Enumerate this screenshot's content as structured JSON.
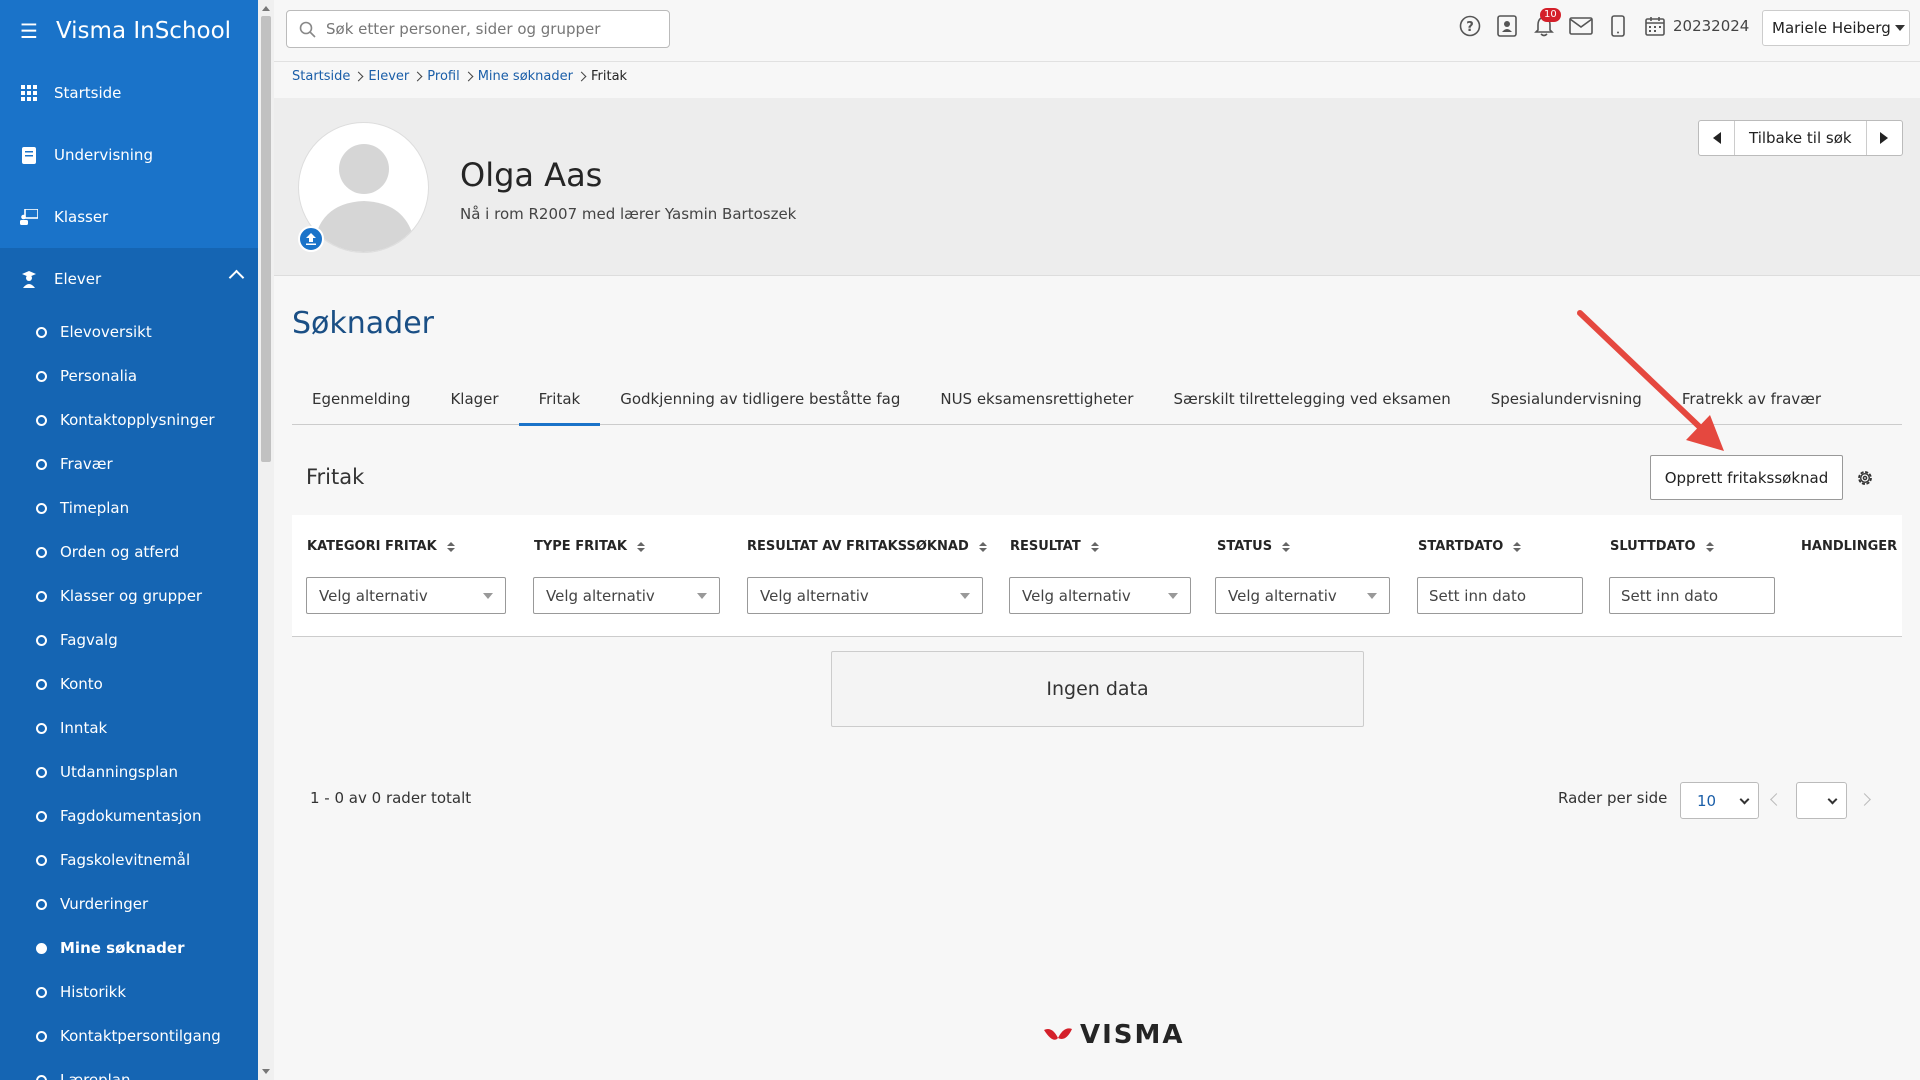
{
  "app": {
    "title": "Visma InSchool"
  },
  "sidebar": {
    "main_items": [
      {
        "label": "Startside",
        "icon": "grid-icon"
      },
      {
        "label": "Undervisning",
        "icon": "book-icon"
      },
      {
        "label": "Klasser",
        "icon": "classroom-icon"
      },
      {
        "label": "Elever",
        "icon": "student-icon"
      }
    ],
    "sub_items": [
      {
        "label": "Elevoversikt"
      },
      {
        "label": "Personalia"
      },
      {
        "label": "Kontaktopplysninger"
      },
      {
        "label": "Fravær"
      },
      {
        "label": "Timeplan"
      },
      {
        "label": "Orden og atferd"
      },
      {
        "label": "Klasser og grupper"
      },
      {
        "label": "Fagvalg"
      },
      {
        "label": "Konto"
      },
      {
        "label": "Inntak"
      },
      {
        "label": "Utdanningsplan"
      },
      {
        "label": "Fagdokumentasjon"
      },
      {
        "label": "Fagskolevitnemål"
      },
      {
        "label": "Vurderinger"
      },
      {
        "label": "Mine søknader"
      },
      {
        "label": "Historikk"
      },
      {
        "label": "Kontaktpersontilgang"
      },
      {
        "label": "Læreplan"
      }
    ],
    "active_sub": "Mine søknader"
  },
  "topbar": {
    "search_placeholder": "Søk etter personer, sider og grupper",
    "notification_count": "10",
    "school_year": "20232024",
    "user_name": "Mariele Heiberg"
  },
  "breadcrumb": [
    "Startside",
    "Elever",
    "Profil",
    "Mine søknader",
    "Fritak"
  ],
  "profile": {
    "name": "Olga Aas",
    "location": "Nå i rom R2007 med lærer Yasmin Bartoszek",
    "back_label": "Tilbake til søk"
  },
  "main": {
    "title": "Søknader",
    "tabs": [
      {
        "label": "Egenmelding"
      },
      {
        "label": "Klager"
      },
      {
        "label": "Fritak"
      },
      {
        "label": "Godkjenning av tidligere beståtte fag"
      },
      {
        "label": "NUS eksamensrettigheter"
      },
      {
        "label": "Særskilt tilrettelegging ved eksamen"
      },
      {
        "label": "Spesialundervisning"
      },
      {
        "label": "Fratrekk av fravær"
      }
    ],
    "active_tab": "Fritak",
    "section_title": "Fritak",
    "create_button": "Opprett fritakssøknad",
    "columns": [
      {
        "label": "KATEGORI FRITAK",
        "filter": "Velg alternativ"
      },
      {
        "label": "TYPE FRITAK",
        "filter": "Velg alternativ"
      },
      {
        "label": "RESULTAT AV FRITAKSSØKNAD",
        "filter": "Velg alternativ"
      },
      {
        "label": "RESULTAT",
        "filter": "Velg alternativ"
      },
      {
        "label": "STATUS",
        "filter": "Velg alternativ"
      },
      {
        "label": "STARTDATO",
        "filter": "Sett inn dato"
      },
      {
        "label": "SLUTTDATO",
        "filter": "Sett inn dato"
      },
      {
        "label": "HANDLINGER"
      }
    ],
    "no_data": "Ingen data",
    "row_count": "1 - 0 av 0 rader totalt",
    "rows_per_page_label": "Rader per side",
    "rows_per_page_value": "10"
  },
  "footer": {
    "logo_text": "VISMA"
  },
  "colors": {
    "sidebar": "#1a73c9",
    "accent": "#1a73c9",
    "arrow": "#e5483f",
    "badge": "#d4202a"
  }
}
